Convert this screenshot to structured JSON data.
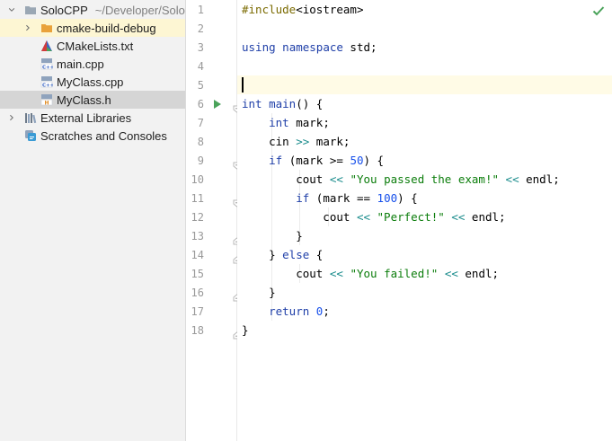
{
  "project": {
    "root_label": "SoloCPP",
    "root_path": "~/Developer/Solo",
    "items": [
      {
        "label": "cmake-build-debug"
      },
      {
        "label": "CMakeLists.txt"
      },
      {
        "label": "main.cpp"
      },
      {
        "label": "MyClass.cpp"
      },
      {
        "label": "MyClass.h"
      },
      {
        "label": "External Libraries"
      },
      {
        "label": "Scratches and Consoles"
      }
    ]
  },
  "editor": {
    "line_numbers": [
      "1",
      "2",
      "3",
      "4",
      "5",
      "6",
      "7",
      "8",
      "9",
      "10",
      "11",
      "12",
      "13",
      "14",
      "15",
      "16",
      "17",
      "18"
    ],
    "status_icon": "check-icon",
    "lines": [
      [
        [
          "pp",
          "#include"
        ],
        [
          "",
          "<iostream>"
        ]
      ],
      [],
      [
        [
          "kw",
          "using"
        ],
        [
          "",
          " "
        ],
        [
          "kw",
          "namespace"
        ],
        [
          "",
          " std;"
        ]
      ],
      [],
      [],
      [
        [
          "kw",
          "int"
        ],
        [
          "",
          " "
        ],
        [
          "fn",
          "main"
        ],
        [
          "",
          "() {"
        ]
      ],
      [
        [
          "",
          "    "
        ],
        [
          "kw",
          "int"
        ],
        [
          "",
          " mark;"
        ]
      ],
      [
        [
          "",
          "    cin "
        ],
        [
          "op",
          ">>"
        ],
        [
          "",
          " mark;"
        ]
      ],
      [
        [
          "",
          "    "
        ],
        [
          "kw",
          "if"
        ],
        [
          "",
          " (mark >= "
        ],
        [
          "num",
          "50"
        ],
        [
          "",
          ") {"
        ]
      ],
      [
        [
          "",
          "        cout "
        ],
        [
          "op",
          "<<"
        ],
        [
          "",
          " "
        ],
        [
          "str",
          "\"You passed the exam!\""
        ],
        [
          "",
          " "
        ],
        [
          "op",
          "<<"
        ],
        [
          "",
          " endl;"
        ]
      ],
      [
        [
          "",
          "        "
        ],
        [
          "kw",
          "if"
        ],
        [
          "",
          " (mark == "
        ],
        [
          "num",
          "100"
        ],
        [
          "",
          ") {"
        ]
      ],
      [
        [
          "",
          "            cout "
        ],
        [
          "op",
          "<<"
        ],
        [
          "",
          " "
        ],
        [
          "str",
          "\"Perfect!\""
        ],
        [
          "",
          " "
        ],
        [
          "op",
          "<<"
        ],
        [
          "",
          " endl;"
        ]
      ],
      [
        [
          "",
          "        }"
        ]
      ],
      [
        [
          "",
          "    } "
        ],
        [
          "kw",
          "else"
        ],
        [
          "",
          " {"
        ]
      ],
      [
        [
          "",
          "        cout "
        ],
        [
          "op",
          "<<"
        ],
        [
          "",
          " "
        ],
        [
          "str",
          "\"You failed!\""
        ],
        [
          "",
          " "
        ],
        [
          "op",
          "<<"
        ],
        [
          "",
          " endl;"
        ]
      ],
      [
        [
          "",
          "    }"
        ]
      ],
      [
        [
          "",
          "    "
        ],
        [
          "kw",
          "return"
        ],
        [
          "",
          " "
        ],
        [
          "num",
          "0"
        ],
        [
          "",
          ";"
        ]
      ],
      [
        [
          "",
          "}"
        ]
      ]
    ]
  },
  "colors": {
    "keyword": "#1f3fa8",
    "string": "#0b7d0b",
    "number": "#1750eb",
    "preprocessor": "#7a6a00",
    "operator": "#1a8c8c",
    "run_marker": "#4aa35a"
  }
}
